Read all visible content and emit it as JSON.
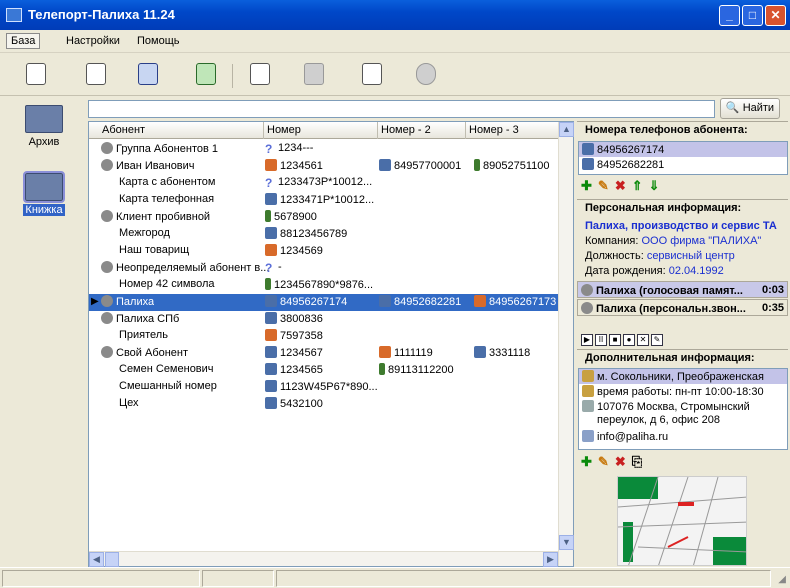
{
  "window": {
    "title": "Телепорт-Палиха 11.24"
  },
  "menu": [
    "База",
    "Настройки",
    "Помощь"
  ],
  "nav": [
    {
      "label": "Архив"
    },
    {
      "label": "Книжка"
    }
  ],
  "search": {
    "placeholder": "",
    "find_label": "Найти"
  },
  "grid": {
    "headers": [
      "Абонент",
      "Номер",
      "Номер - 2",
      "Номер - 3"
    ],
    "rows": [
      {
        "name": "Группа Абонентов 1",
        "n1": "1234---",
        "n2": "",
        "n3": ""
      },
      {
        "name": "Иван Иванович",
        "n1": "1234561",
        "n2": "84957700001",
        "n3": "89052751100"
      },
      {
        "name": "Карта с абонентом",
        "n1": "1233473P*10012...",
        "n2": "",
        "n3": ""
      },
      {
        "name": "Карта телефонная",
        "n1": "1233471P*10012...",
        "n2": "",
        "n3": ""
      },
      {
        "name": "Клиент пробивной",
        "n1": "5678900",
        "n2": "",
        "n3": ""
      },
      {
        "name": "Межгород",
        "n1": "88123456789",
        "n2": "",
        "n3": ""
      },
      {
        "name": "Наш товарищ",
        "n1": "1234569",
        "n2": "",
        "n3": ""
      },
      {
        "name": "Неопределяемый абонент в...",
        "n1": "-",
        "n2": "",
        "n3": ""
      },
      {
        "name": "Номер 42 символа",
        "n1": "1234567890*9876...",
        "n2": "",
        "n3": ""
      },
      {
        "name": "Палиха",
        "n1": "84956267174",
        "n2": "84952682281",
        "n3": "84956267173"
      },
      {
        "name": "Палиха СПб",
        "n1": "3800836",
        "n2": "",
        "n3": ""
      },
      {
        "name": "Приятель",
        "n1": "7597358",
        "n2": "",
        "n3": ""
      },
      {
        "name": "Свой Абонент",
        "n1": "1234567",
        "n2": "1111119",
        "n3": "3331118"
      },
      {
        "name": "Семен Семенович",
        "n1": "1234565",
        "n2": "89113112200",
        "n3": ""
      },
      {
        "name": "Смешанный номер",
        "n1": "1123W45P67*890...",
        "n2": "",
        "n3": ""
      },
      {
        "name": "Цех",
        "n1": "5432100",
        "n2": "",
        "n3": ""
      }
    ]
  },
  "right": {
    "phones_title": "Номера телефонов абонента:",
    "phones": [
      "84956267174",
      "84952682281"
    ],
    "personal_title": "Персональная информация:",
    "company_name": "Палиха, производство и сервис ТА",
    "company_label": "Компания:",
    "company_value": "ООО фирма \"ПАЛИХА\"",
    "position_label": "Должность:",
    "position_value": "сервисный центр",
    "birth_label": "Дата рождения:",
    "birth_value": "02.04.1992",
    "rec1": "Палиха (голосовая памят...",
    "rec1_time": "0:03",
    "rec2": "Палиха (персональн.звон...",
    "rec2_time": "0:35",
    "extra_title": "Дополнительная информация:",
    "extra": [
      "м. Сокольники, Преображенская",
      "время работы: пн-пт 10:00-18:30",
      "107076 Москва, Стромынский",
      "переулок, д 6, офис 208",
      "info@paliha.ru"
    ]
  }
}
